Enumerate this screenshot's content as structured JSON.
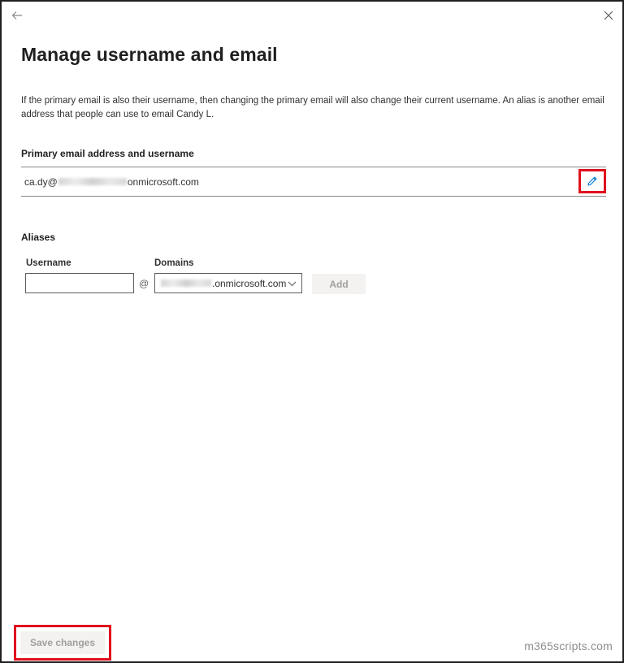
{
  "panel": {
    "title": "Manage username and email",
    "description": "If the primary email is also their username, then changing the primary email will also change their current username. An alias is another email address that people can use to email Candy L."
  },
  "primary": {
    "label": "Primary email address and username",
    "value_prefix": "ca.dy@",
    "value_suffix": "onmicrosoft.com"
  },
  "aliases": {
    "label": "Aliases",
    "username_label": "Username",
    "username_value": "",
    "at_symbol": "@",
    "domains_label": "Domains",
    "domain_selected_suffix": ".onmicrosoft.com",
    "add_label": "Add"
  },
  "footer": {
    "save_label": "Save changes",
    "watermark": "m365scripts.com"
  },
  "colors": {
    "highlight": "#e0101c",
    "accent": "#0078d4",
    "disabled_text": "#a19f9d",
    "disabled_bg": "#f3f2f1"
  },
  "icons": {
    "back": "back-arrow-icon",
    "close": "close-icon",
    "edit": "pencil-icon",
    "dropdown": "chevron-down-icon"
  }
}
